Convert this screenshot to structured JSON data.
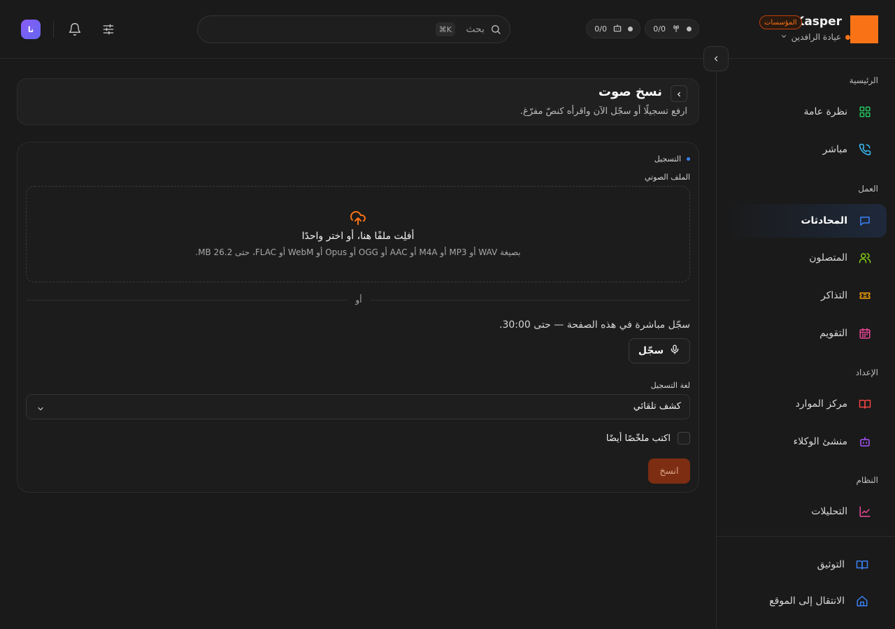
{
  "brand": {
    "name": "Kasper",
    "badge": "المؤسسات",
    "workspace": "عيادة الرافدين",
    "logo_color": "#f97316"
  },
  "header": {
    "avatar_initials": "نا",
    "search_label": "بحث",
    "search_shortcut": "⌘K",
    "status_pills": [
      {
        "icon": "broadcast-icon",
        "value": "0/0"
      },
      {
        "icon": "robot-icon",
        "value": "0/0"
      }
    ]
  },
  "sidebar": {
    "sections": [
      {
        "label": "الرئيسية"
      },
      {
        "label": "العمل"
      },
      {
        "label": "الإعداد"
      },
      {
        "label": "النظام"
      }
    ],
    "items": [
      {
        "label": "نظرة عامة",
        "icon": "grid-icon",
        "color": "#22c55e"
      },
      {
        "label": "مباشر",
        "icon": "phone-call-icon",
        "color": "#38bdf8"
      },
      {
        "label": "المحادثات",
        "icon": "chat-icon",
        "color": "#3b82f6",
        "active": true
      },
      {
        "label": "المتصلون",
        "icon": "users-icon",
        "color": "#84cc16"
      },
      {
        "label": "التذاكر",
        "icon": "ticket-icon",
        "color": "#f59e0b"
      },
      {
        "label": "التقويم",
        "icon": "calendar-icon",
        "color": "#ec4899"
      },
      {
        "label": "مركز الموارد",
        "icon": "book-icon",
        "color": "#ef4444"
      },
      {
        "label": "منشئ الوكلاء",
        "icon": "bot-icon",
        "color": "#a855f7"
      },
      {
        "label": "التحليلات",
        "icon": "chart-icon",
        "color": "#ec4899"
      }
    ],
    "footer": [
      {
        "label": "التوثيق",
        "icon": "docs-book-icon",
        "color": "#3b82f6"
      },
      {
        "label": "الانتقال إلى الموقع",
        "icon": "home-icon",
        "color": "#3b82f6"
      }
    ]
  },
  "page": {
    "title": "نسخ صوت",
    "subtitle": "ارفع تسجيلًا أو سجّل الآن واقرأه كنصّ مفرّغ."
  },
  "form": {
    "state_label": "التسجيل",
    "file_label": "الملف الصوتي",
    "dropzone_title": "أفلِت ملفًا هنا، أو اختر واحدًا",
    "dropzone_sub": "بصيغة WAV أو MP3 أو M4A أو AAC أو OGG أو Opus أو WebM أو FLAC، حتى 26.2 MB.",
    "or_text": "أو",
    "record_hint": "سجّل مباشرة في هذه الصفحة — حتى 30:00.",
    "record_button": "سجّل",
    "language_label": "لغة التسجيل",
    "language_value": "كشف تلقائي",
    "summary_label": "اكتب ملخّصًا أيضًا",
    "summary_checked": false,
    "submit_button": "انسخ",
    "accent_color": "#f97316"
  }
}
